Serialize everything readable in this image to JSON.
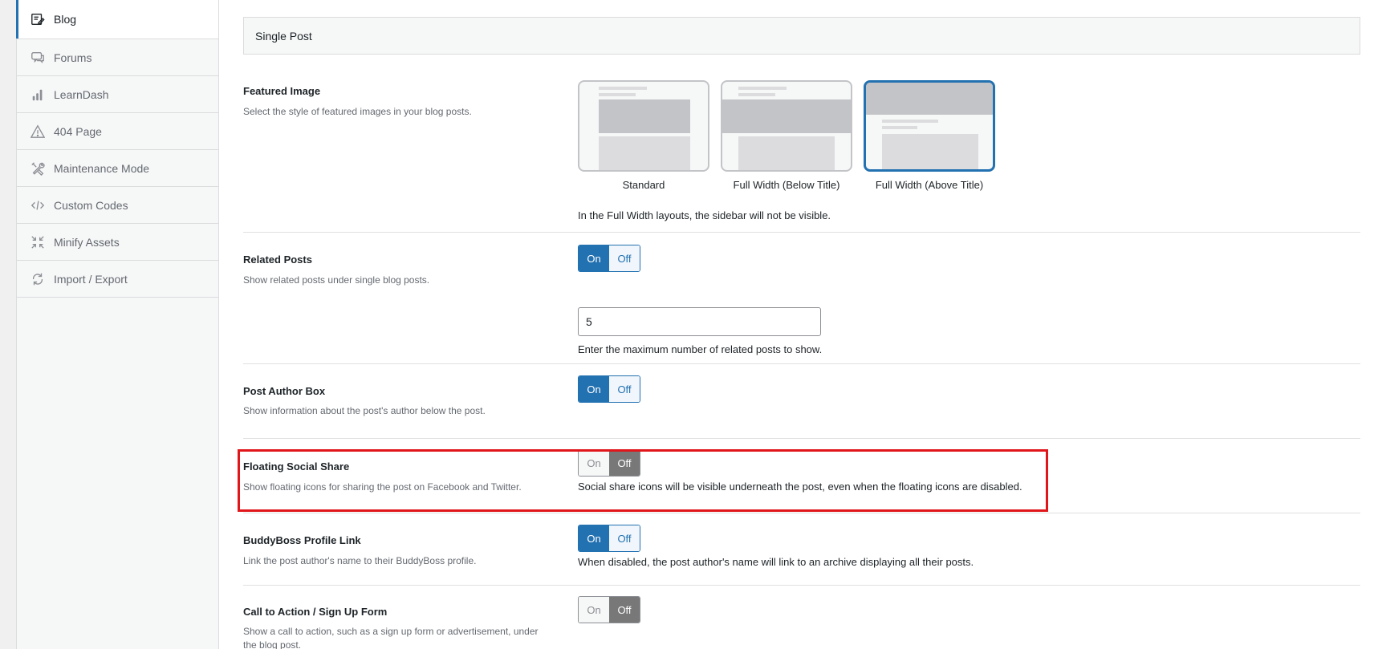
{
  "sidebar": {
    "items": [
      {
        "label": "Blog",
        "icon": "edit-icon"
      },
      {
        "label": "Forums",
        "icon": "chat-icon"
      },
      {
        "label": "LearnDash",
        "icon": "chart-icon"
      },
      {
        "label": "404 Page",
        "icon": "warning-icon"
      },
      {
        "label": "Maintenance Mode",
        "icon": "tools-icon"
      },
      {
        "label": "Custom Codes",
        "icon": "code-icon"
      },
      {
        "label": "Minify Assets",
        "icon": "compress-icon"
      },
      {
        "label": "Import / Export",
        "icon": "sync-icon"
      }
    ]
  },
  "section": {
    "title": "Single Post"
  },
  "featured_image": {
    "title": "Featured Image",
    "desc": "Select the style of featured images in your blog posts.",
    "options": [
      "Standard",
      "Full Width (Below Title)",
      "Full Width (Above Title)"
    ],
    "selected": "Full Width (Above Title)",
    "note": "In the Full Width layouts, the sidebar will not be visible."
  },
  "related_posts": {
    "title": "Related Posts",
    "desc": "Show related posts under single blog posts.",
    "state": "On",
    "count_value": "5",
    "count_note": "Enter the maximum number of related posts to show."
  },
  "author_box": {
    "title": "Post Author Box",
    "desc": "Show information about the post's author below the post.",
    "state": "On"
  },
  "social_share": {
    "title": "Floating Social Share",
    "desc": "Show floating icons for sharing the post on Facebook and Twitter.",
    "state": "Off",
    "note": "Social share icons will be visible underneath the post, even when the floating icons are disabled."
  },
  "profile_link": {
    "title": "BuddyBoss Profile Link",
    "desc": "Link the post author's name to their BuddyBoss profile.",
    "state": "On",
    "note": "When disabled, the post author's name will link to an archive displaying all their posts."
  },
  "cta": {
    "title": "Call to Action / Sign Up Form",
    "desc": "Show a call to action, such as a sign up form or advertisement, under the blog post.",
    "state": "Off"
  },
  "toggle_labels": {
    "on": "On",
    "off": "Off"
  },
  "colors": {
    "accent": "#2271b1",
    "highlight": "#e0161a",
    "off_dark": "#787878"
  }
}
